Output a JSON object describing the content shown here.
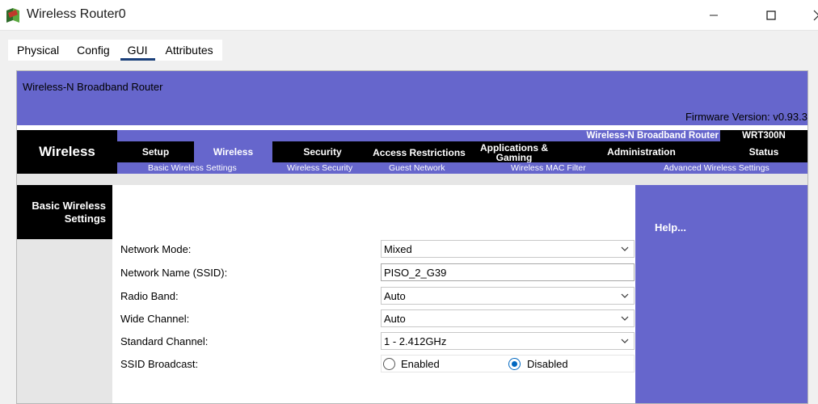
{
  "window": {
    "title": "Wireless Router0",
    "icon": "router-app-icon"
  },
  "tabs": [
    {
      "label": "Physical",
      "active": false
    },
    {
      "label": "Config",
      "active": false
    },
    {
      "label": "GUI",
      "active": true
    },
    {
      "label": "Attributes",
      "active": false
    }
  ],
  "header": {
    "product_name": "Wireless-N Broadband Router",
    "firmware": "Firmware Version: v0.93.3"
  },
  "nav": {
    "brand": "Wireless",
    "product_label": "Wireless-N Broadband Router",
    "model": "WRT300N",
    "items": [
      {
        "label": "Setup"
      },
      {
        "label": "Wireless"
      },
      {
        "label": "Security"
      },
      {
        "label": "Access Restrictions"
      },
      {
        "label": "Applications & Gaming"
      },
      {
        "label": "Administration"
      },
      {
        "label": "Status"
      }
    ],
    "subitems": [
      {
        "label": "Basic Wireless Settings"
      },
      {
        "label": "Wireless Security"
      },
      {
        "label": "Guest Network"
      },
      {
        "label": "Wireless MAC Filter"
      },
      {
        "label": "Advanced Wireless Settings"
      }
    ]
  },
  "section_title": "Basic Wireless Settings",
  "form": {
    "network_mode": {
      "label": "Network Mode:",
      "value": "Mixed"
    },
    "ssid": {
      "label": "Network Name (SSID):",
      "value": "PISO_2_G39"
    },
    "radio_band": {
      "label": "Radio Band:",
      "value": "Auto"
    },
    "wide_channel": {
      "label": "Wide Channel:",
      "value": "Auto"
    },
    "standard_channel": {
      "label": "Standard Channel:",
      "value": "1 - 2.412GHz"
    },
    "ssid_broadcast": {
      "label": "SSID Broadcast:",
      "enabled_label": "Enabled",
      "disabled_label": "Disabled",
      "selected": "Disabled"
    }
  },
  "help": {
    "label": "Help..."
  },
  "colors": {
    "purple": "#6666cc",
    "black": "#000000",
    "radio_accent": "#0067c0"
  }
}
